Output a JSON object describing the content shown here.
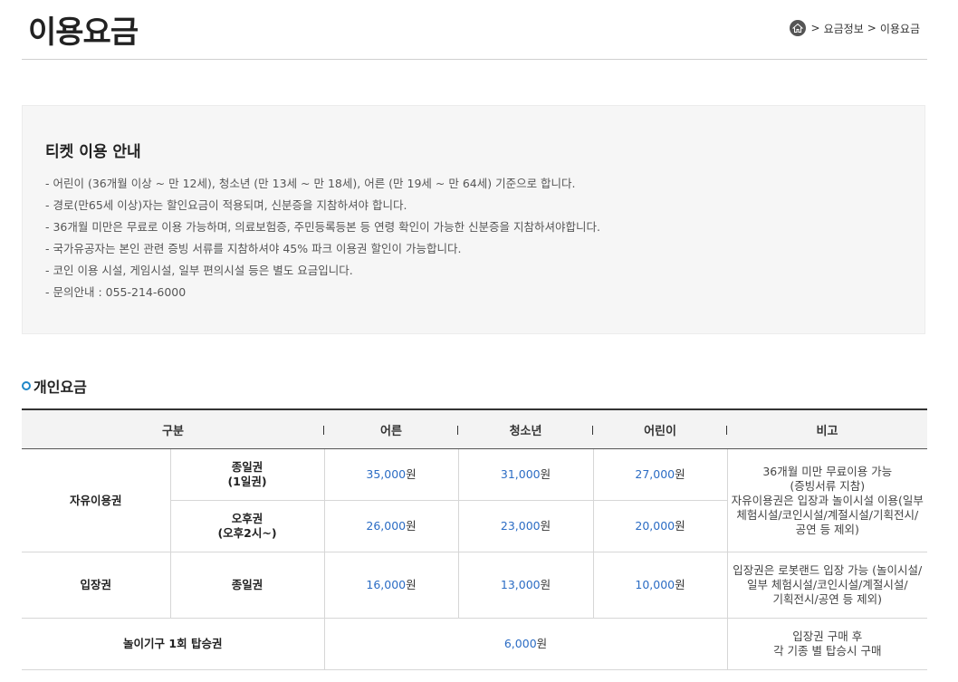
{
  "header": {
    "title": "이용요금",
    "breadcrumb": [
      "요금정보",
      "이용요금"
    ],
    "breadcrumb_sep": ">"
  },
  "notice": {
    "title": "티켓 이용 안내",
    "items": [
      "- 어린이 (36개월 이상 ~ 만 12세), 청소년 (만 13세 ~ 만 18세), 어른 (만 19세 ~ 만 64세) 기준으로 합니다.",
      "- 경로(만65세 이상)자는 할인요금이 적용되며, 신분증을 지참하셔야 합니다.",
      "- 36개월 미만은 무료로 이용 가능하며, 의료보험증, 주민등록등본 등 연령 확인이 가능한 신분증을 지참하셔야합니다.",
      "- 국가유공자는 본인 관련 증빙 서류를 지참하셔야 45% 파크 이용권 할인이 가능합니다.",
      "- 코인 이용 시설, 게임시설, 일부 편의시설 등은 별도 요금입니다.",
      "- 문의안내 : 055-214-6000"
    ]
  },
  "section": {
    "title": "개인요금"
  },
  "table": {
    "headers": [
      "구분",
      "어른",
      "청소년",
      "어린이",
      "비고"
    ],
    "unit": "원",
    "rows": {
      "free_pass": {
        "label": "자유이용권",
        "full_day": {
          "line1": "종일권",
          "line2": "(1일권)",
          "adult": "35,000",
          "youth": "31,000",
          "child": "27,000"
        },
        "afternoon": {
          "line1": "오후권",
          "line2": "(오후2시~)",
          "adult": "26,000",
          "youth": "23,000",
          "child": "20,000"
        },
        "note": [
          "36개월 미만 무료이용 가능",
          "(증빙서류 지참)",
          "자유이용권은 입장과 놀이시설 이용(일부",
          "체험시설/코인시설/계절시설/기획전시/",
          "공연 등 제외)"
        ]
      },
      "admission": {
        "label": "입장권",
        "type": "종일권",
        "adult": "16,000",
        "youth": "13,000",
        "child": "10,000",
        "note": [
          "입장권은 로봇랜드 입장 가능 (놀이시설/",
          "일부 체험시설/코인시설/계절시설/",
          "기획전시/공연 등 제외)"
        ]
      },
      "ride": {
        "label": "놀이기구 1회 탑승권",
        "price": "6,000",
        "note": [
          "입장권 구매 후",
          "각 기종 별 탑승시 구매"
        ]
      }
    }
  },
  "colors": {
    "accent": "#1f87c8",
    "price": "#2b6cc4"
  }
}
